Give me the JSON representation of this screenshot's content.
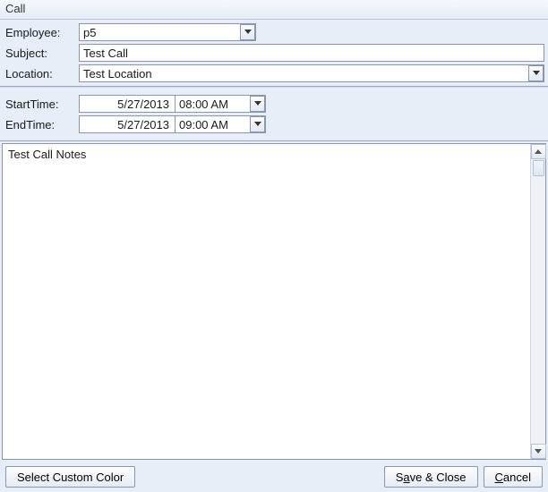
{
  "window": {
    "title": "Call"
  },
  "labels": {
    "employee": "Employee:",
    "subject": "Subject:",
    "location": "Location:",
    "start": "StartTime:",
    "end": "EndTime:"
  },
  "values": {
    "employee": "p5",
    "subject": "Test Call",
    "location": "Test Location",
    "startDate": "5/27/2013",
    "startTime": "08:00 AM",
    "endDate": "5/27/2013",
    "endTime": "09:00 AM",
    "notes": "Test Call Notes"
  },
  "buttons": {
    "selectColor": "Select Custom Color",
    "saveClose_pre": "S",
    "saveClose_und": "a",
    "saveClose_post": "ve & Close",
    "cancel_pre": "",
    "cancel_und": "C",
    "cancel_post": "ancel"
  }
}
